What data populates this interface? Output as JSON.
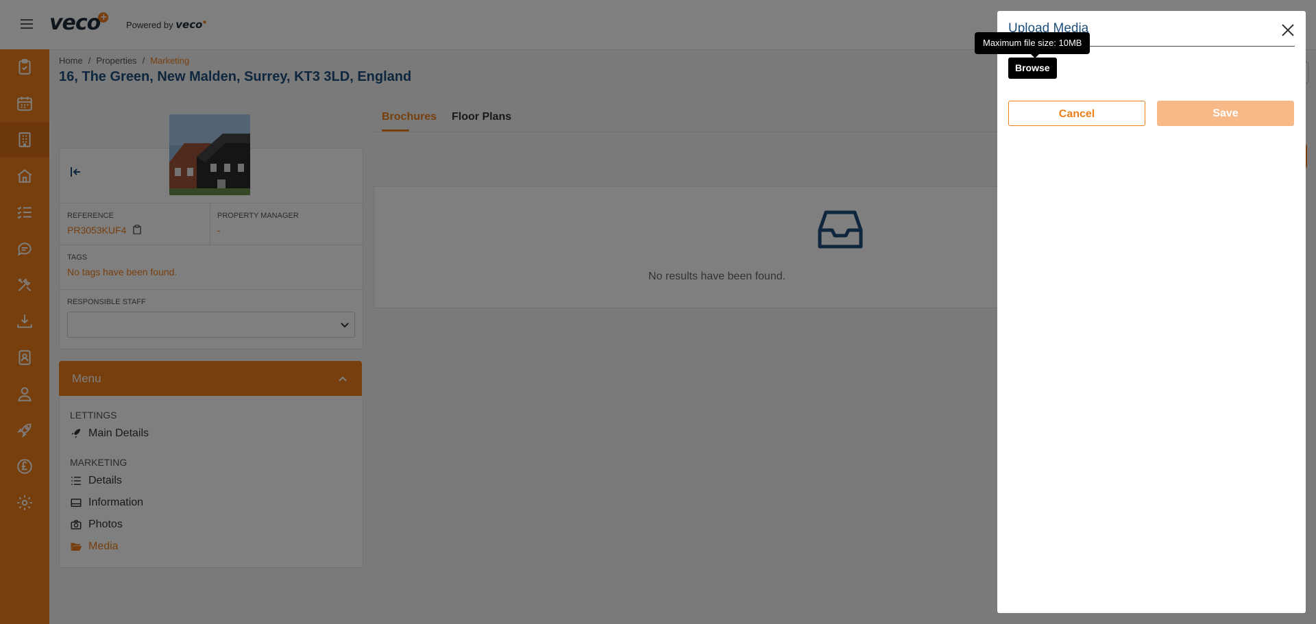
{
  "colors": {
    "accent": "#ef7f1a",
    "title_blue": "#1d4f7c",
    "overlay": "rgba(0,0,0,0.5)"
  },
  "header": {
    "logo_text": "veco",
    "logo_plus": "+",
    "powered_by_label": "Powered by",
    "powered_by_brand": "veco"
  },
  "sidebar": {
    "items": [
      {
        "icon": "clipboard-check-icon"
      },
      {
        "icon": "calendar-icon"
      },
      {
        "icon": "building-icon",
        "active": true
      },
      {
        "icon": "house-icon"
      },
      {
        "icon": "task-list-icon"
      },
      {
        "icon": "chat-bubble-icon"
      },
      {
        "icon": "tools-icon"
      },
      {
        "icon": "download-tray-icon"
      },
      {
        "icon": "contact-book-icon"
      },
      {
        "icon": "user-icon"
      },
      {
        "icon": "rocket-icon"
      },
      {
        "icon": "pound-coin-icon"
      },
      {
        "icon": "gear-icon"
      }
    ]
  },
  "breadcrumb": {
    "home": "Home",
    "properties": "Properties",
    "current": "Marketing",
    "separator": "/"
  },
  "page": {
    "title": "16, The Green, New Malden, Surrey, KT3 3LD, England"
  },
  "property": {
    "reference_label": "REFERENCE",
    "reference_value": "PR3053KUF4",
    "manager_label": "PROPERTY MANAGER",
    "manager_value": "-",
    "tags_label": "TAGS",
    "tags_value": "No tags have been found.",
    "staff_label": "RESPONSIBLE STAFF",
    "staff_value": ""
  },
  "menu": {
    "title": "Menu",
    "groups": [
      {
        "label": "LETTINGS",
        "items": [
          {
            "label": "Main Details",
            "icon": "rocket-icon"
          }
        ]
      },
      {
        "label": "MARKETING",
        "items": [
          {
            "label": "Details",
            "icon": "list-icon"
          },
          {
            "label": "Information",
            "icon": "card-icon"
          },
          {
            "label": "Photos",
            "icon": "camera-icon"
          },
          {
            "label": "Media",
            "icon": "folder-open-icon",
            "active": true
          }
        ]
      }
    ]
  },
  "tabs": [
    {
      "label": "Brochures",
      "active": true
    },
    {
      "label": "Floor Plans"
    }
  ],
  "empty_state": {
    "text": "No results have been found.",
    "icon": "inbox-tray-icon"
  },
  "modal": {
    "title": "Upload Media",
    "tooltip": "Maximum file size: 10MB",
    "browse_label": "Browse",
    "cancel_label": "Cancel",
    "save_label": "Save",
    "close_icon": "close-icon"
  }
}
